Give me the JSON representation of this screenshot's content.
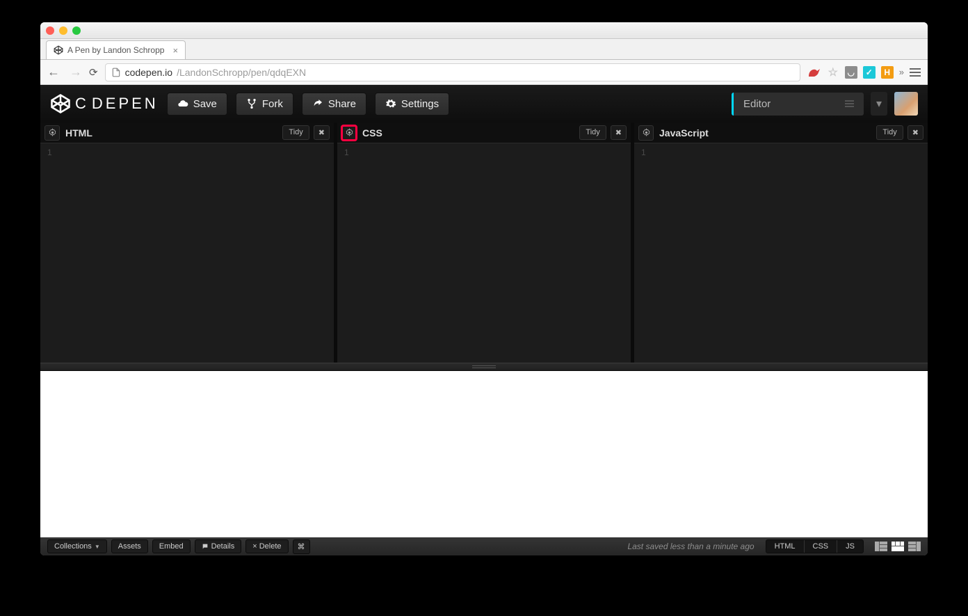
{
  "browser": {
    "tab_title": "A Pen by Landon Schropp",
    "url_host": "codepen.io",
    "url_path": "/LandonSchropp/pen/qdqEXN",
    "ext_more": "»",
    "ext_h": "H"
  },
  "header": {
    "logo_text": "DEPEN",
    "buttons": {
      "save": "Save",
      "fork": "Fork",
      "share": "Share",
      "settings": "Settings"
    },
    "mode_label": "Editor"
  },
  "panels": {
    "html": {
      "title": "HTML",
      "tidy": "Tidy",
      "line": "1"
    },
    "css": {
      "title": "CSS",
      "tidy": "Tidy",
      "line": "1"
    },
    "js": {
      "title": "JavaScript",
      "tidy": "Tidy",
      "line": "1"
    }
  },
  "footer": {
    "collections": "Collections",
    "assets": "Assets",
    "embed": "Embed",
    "details": "Details",
    "delete": "× Delete",
    "status": "Last saved less than a minute ago",
    "views": {
      "html": "HTML",
      "css": "CSS",
      "js": "JS"
    }
  }
}
